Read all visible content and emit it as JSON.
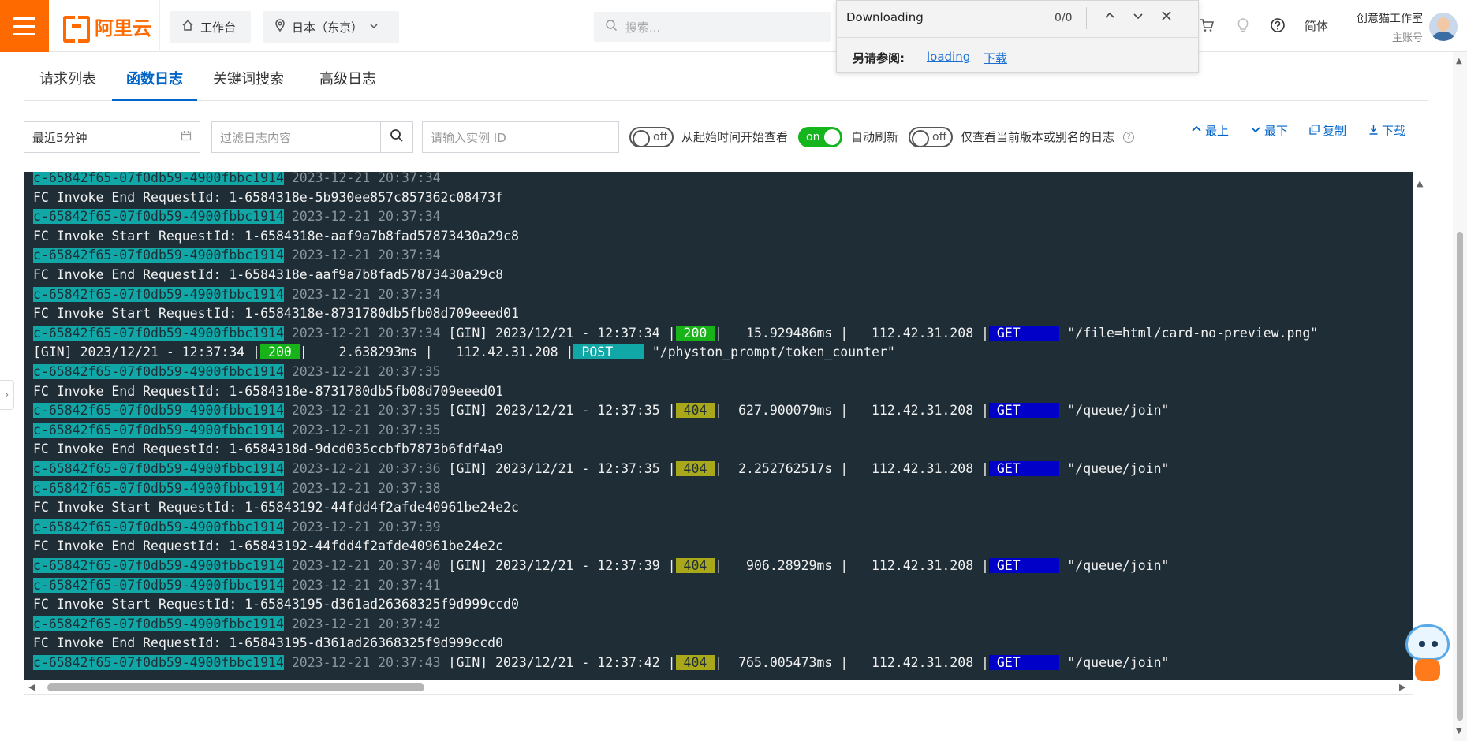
{
  "topbar": {
    "brand": "阿里云",
    "workbench": "工作台",
    "region": "日本（东京）",
    "search_placeholder": "搜索...",
    "lang": "简体",
    "account_name": "创意猫工作室",
    "account_type": "主账号"
  },
  "findbar": {
    "query": "Downloading",
    "count": "0/0",
    "see_also_label": "另请参阅:",
    "link1": "loading",
    "link2": "下载"
  },
  "tabs": [
    "请求列表",
    "函数日志",
    "关键词搜索",
    "高级日志"
  ],
  "filters": {
    "time_range": "最近5分钟",
    "log_filter_placeholder": "过滤日志内容",
    "instance_placeholder": "请输入实例 ID",
    "toggle_off": "off",
    "toggle_on": "on",
    "from_start_label": "从起始时间开始查看",
    "auto_refresh_label": "自动刷新",
    "current_version_label": "仅查看当前版本或别名的日志"
  },
  "actions": {
    "top": "最上",
    "bottom": "最下",
    "copy": "复制",
    "download": "下载"
  },
  "log": {
    "instance": "c-65842f65-07f0db59-4900fbbc1914",
    "lines": [
      {
        "type": "inst",
        "ts": "2023-12-21 20:37:34"
      },
      {
        "type": "text",
        "text": "FC Invoke End RequestId: 1-6584318e-5b930ee857c857362c08473f"
      },
      {
        "type": "inst",
        "ts": "2023-12-21 20:37:34"
      },
      {
        "type": "text",
        "text": "FC Invoke Start RequestId: 1-6584318e-aaf9a7b8fad57873430a29c8"
      },
      {
        "type": "inst",
        "ts": "2023-12-21 20:37:34"
      },
      {
        "type": "text",
        "text": "FC Invoke End RequestId: 1-6584318e-aaf9a7b8fad57873430a29c8"
      },
      {
        "type": "inst",
        "ts": "2023-12-21 20:37:34"
      },
      {
        "type": "text",
        "text": "FC Invoke Start RequestId: 1-6584318e-8731780db5fb08d709eeed01"
      },
      {
        "type": "gin",
        "ts": "2023-12-21 20:37:34",
        "gin_time": "2023/12/21 - 12:37:34",
        "status": "200",
        "latency": "   15.929486ms",
        "ip": "112.42.31.208",
        "method": "GET",
        "path": "\"/file=html/card-no-preview.png\""
      },
      {
        "type": "ginonly",
        "gin_time": "2023/12/21 - 12:37:34",
        "status": "200",
        "latency": "    2.638293ms",
        "ip": "112.42.31.208",
        "method": "POST",
        "path": "\"/physton_prompt/token_counter\""
      },
      {
        "type": "inst",
        "ts": "2023-12-21 20:37:35"
      },
      {
        "type": "text",
        "text": "FC Invoke End RequestId: 1-6584318e-8731780db5fb08d709eeed01"
      },
      {
        "type": "gin",
        "ts": "2023-12-21 20:37:35",
        "gin_time": "2023/12/21 - 12:37:35",
        "status": "404",
        "latency": "  627.900079ms",
        "ip": "112.42.31.208",
        "method": "GET",
        "path": "\"/queue/join\""
      },
      {
        "type": "inst",
        "ts": "2023-12-21 20:37:35"
      },
      {
        "type": "text",
        "text": "FC Invoke End RequestId: 1-6584318d-9dcd035ccbfb7873b6fdf4a9"
      },
      {
        "type": "gin",
        "ts": "2023-12-21 20:37:36",
        "gin_time": "2023/12/21 - 12:37:35",
        "status": "404",
        "latency": "  2.252762517s",
        "ip": "112.42.31.208",
        "method": "GET",
        "path": "\"/queue/join\""
      },
      {
        "type": "inst",
        "ts": "2023-12-21 20:37:38"
      },
      {
        "type": "text",
        "text": "FC Invoke Start RequestId: 1-65843192-44fdd4f2afde40961be24e2c"
      },
      {
        "type": "inst",
        "ts": "2023-12-21 20:37:39"
      },
      {
        "type": "text",
        "text": "FC Invoke End RequestId: 1-65843192-44fdd4f2afde40961be24e2c"
      },
      {
        "type": "gin",
        "ts": "2023-12-21 20:37:40",
        "gin_time": "2023/12/21 - 12:37:39",
        "status": "404",
        "latency": "   906.28929ms",
        "ip": "112.42.31.208",
        "method": "GET",
        "path": "\"/queue/join\""
      },
      {
        "type": "inst",
        "ts": "2023-12-21 20:37:41"
      },
      {
        "type": "text",
        "text": "FC Invoke Start RequestId: 1-65843195-d361ad26368325f9d999ccd0"
      },
      {
        "type": "inst",
        "ts": "2023-12-21 20:37:42"
      },
      {
        "type": "text",
        "text": "FC Invoke End RequestId: 1-65843195-d361ad26368325f9d999ccd0"
      },
      {
        "type": "gin",
        "ts": "2023-12-21 20:37:43",
        "gin_time": "2023/12/21 - 12:37:42",
        "status": "404",
        "latency": "  765.005473ms",
        "ip": "112.42.31.208",
        "method": "GET",
        "path": "\"/queue/join\""
      }
    ]
  },
  "colors": {
    "brand_orange": "#ff6a00",
    "accent_blue": "#0064c8",
    "log_bg": "#1f2d36",
    "instance_bg": "#11a7a7",
    "status_200": "#18b318",
    "status_404": "#a8a81a",
    "method_get": "#0000c8"
  },
  "icons": [
    "menu-icon",
    "home-icon",
    "location-icon",
    "chevron-down-icon",
    "search-icon",
    "cart-icon",
    "bulb-icon",
    "help-icon",
    "calendar-icon",
    "chevron-up-icon",
    "copy-icon",
    "download-icon",
    "close-icon",
    "assistant-icon"
  ]
}
